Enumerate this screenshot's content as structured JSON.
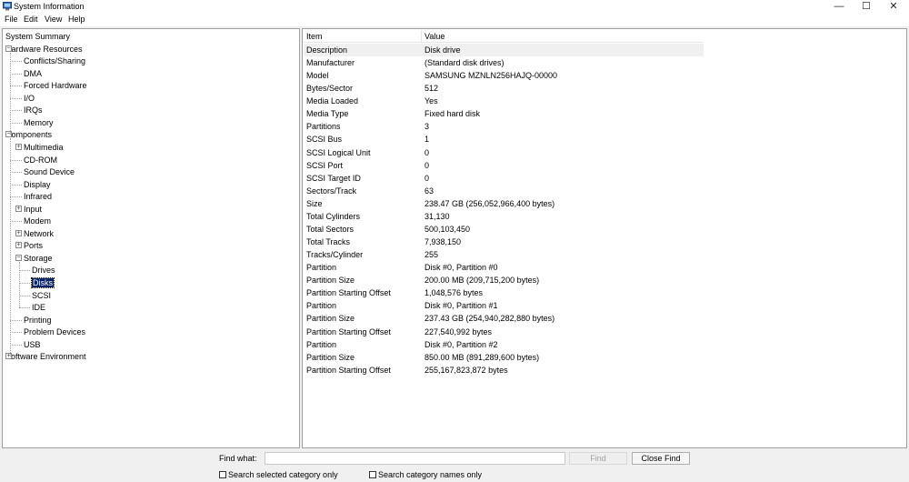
{
  "window": {
    "title": "System Information",
    "controls": {
      "minimize": "—",
      "maximize": "☐",
      "close": "✕"
    }
  },
  "menu": [
    "File",
    "Edit",
    "View",
    "Help"
  ],
  "tree": [
    {
      "label": "System Summary",
      "level": 0,
      "expander": ""
    },
    {
      "label": "Hardware Resources",
      "level": 0,
      "expander": "minus"
    },
    {
      "label": "Conflicts/Sharing",
      "level": 1,
      "expander": ""
    },
    {
      "label": "DMA",
      "level": 1,
      "expander": ""
    },
    {
      "label": "Forced Hardware",
      "level": 1,
      "expander": ""
    },
    {
      "label": "I/O",
      "level": 1,
      "expander": ""
    },
    {
      "label": "IRQs",
      "level": 1,
      "expander": ""
    },
    {
      "label": "Memory",
      "level": 1,
      "expander": ""
    },
    {
      "label": "Components",
      "level": 0,
      "expander": "minus"
    },
    {
      "label": "Multimedia",
      "level": 1,
      "expander": "plus"
    },
    {
      "label": "CD-ROM",
      "level": 1,
      "expander": ""
    },
    {
      "label": "Sound Device",
      "level": 1,
      "expander": ""
    },
    {
      "label": "Display",
      "level": 1,
      "expander": ""
    },
    {
      "label": "Infrared",
      "level": 1,
      "expander": ""
    },
    {
      "label": "Input",
      "level": 1,
      "expander": "plus"
    },
    {
      "label": "Modem",
      "level": 1,
      "expander": ""
    },
    {
      "label": "Network",
      "level": 1,
      "expander": "plus"
    },
    {
      "label": "Ports",
      "level": 1,
      "expander": "plus"
    },
    {
      "label": "Storage",
      "level": 1,
      "expander": "minus"
    },
    {
      "label": "Drives",
      "level": 2,
      "expander": ""
    },
    {
      "label": "Disks",
      "level": 2,
      "expander": "",
      "selected": true
    },
    {
      "label": "SCSI",
      "level": 2,
      "expander": ""
    },
    {
      "label": "IDE",
      "level": 2,
      "expander": ""
    },
    {
      "label": "Printing",
      "level": 1,
      "expander": ""
    },
    {
      "label": "Problem Devices",
      "level": 1,
      "expander": ""
    },
    {
      "label": "USB",
      "level": 1,
      "expander": ""
    },
    {
      "label": "Software Environment",
      "level": 0,
      "expander": "plus"
    }
  ],
  "details": {
    "headers": [
      "Item",
      "Value"
    ],
    "rows": [
      [
        "Description",
        "Disk drive"
      ],
      [
        "Manufacturer",
        "(Standard disk drives)"
      ],
      [
        "Model",
        "SAMSUNG MZNLN256HAJQ-00000"
      ],
      [
        "Bytes/Sector",
        "512"
      ],
      [
        "Media Loaded",
        "Yes"
      ],
      [
        "Media Type",
        "Fixed hard disk"
      ],
      [
        "Partitions",
        "3"
      ],
      [
        "SCSI Bus",
        "1"
      ],
      [
        "SCSI Logical Unit",
        "0"
      ],
      [
        "SCSI Port",
        "0"
      ],
      [
        "SCSI Target ID",
        "0"
      ],
      [
        "Sectors/Track",
        "63"
      ],
      [
        "Size",
        "238.47 GB (256,052,966,400 bytes)"
      ],
      [
        "Total Cylinders",
        "31,130"
      ],
      [
        "Total Sectors",
        "500,103,450"
      ],
      [
        "Total Tracks",
        "7,938,150"
      ],
      [
        "Tracks/Cylinder",
        "255"
      ],
      [
        "Partition",
        "Disk #0, Partition #0"
      ],
      [
        "Partition Size",
        "200.00 MB (209,715,200 bytes)"
      ],
      [
        "Partition Starting Offset",
        "1,048,576 bytes"
      ],
      [
        "Partition",
        "Disk #0, Partition #1"
      ],
      [
        "Partition Size",
        "237.43 GB (254,940,282,880 bytes)"
      ],
      [
        "Partition Starting Offset",
        "227,540,992 bytes"
      ],
      [
        "Partition",
        "Disk #0, Partition #2"
      ],
      [
        "Partition Size",
        "850.00 MB (891,289,600 bytes)"
      ],
      [
        "Partition Starting Offset",
        "255,167,823,872 bytes"
      ]
    ]
  },
  "find": {
    "label": "Find what:",
    "value": "",
    "find_button": "Find",
    "close_button": "Close Find",
    "checkbox_selected": "Search selected category only",
    "checkbox_names": "Search category names only"
  }
}
